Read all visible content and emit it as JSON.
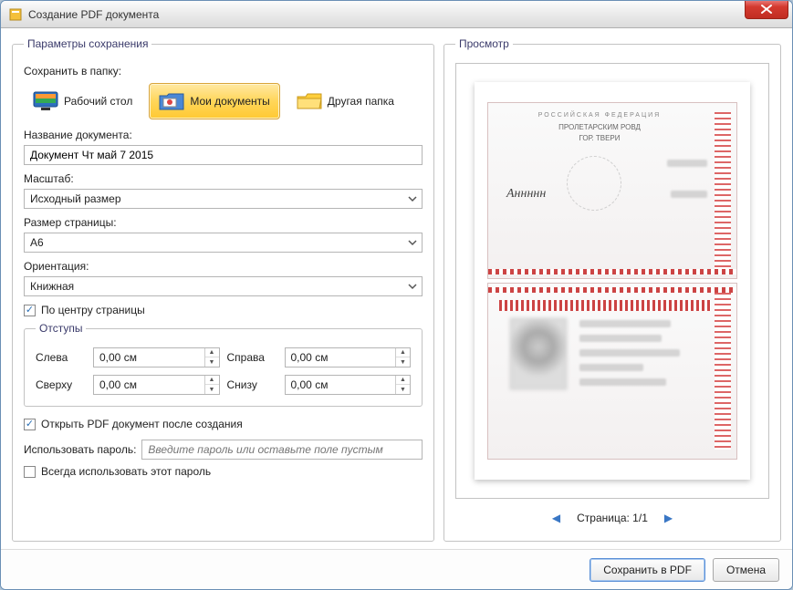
{
  "window": {
    "title": "Создание PDF документа"
  },
  "params": {
    "legend": "Параметры сохранения",
    "save_to_label": "Сохранить в папку:",
    "folders": {
      "desktop": "Рабочий стол",
      "documents": "Мои документы",
      "other": "Другая папка"
    },
    "docname_label": "Название документа:",
    "docname_value": "Документ Чт май 7 2015",
    "scale_label": "Масштаб:",
    "scale_value": "Исходный размер",
    "pagesize_label": "Размер страницы:",
    "pagesize_value": "A6",
    "orientation_label": "Ориентация:",
    "orientation_value": "Книжная",
    "center_label": "По центру страницы",
    "margins": {
      "legend": "Отступы",
      "left_label": "Слева",
      "left_value": "0,00 см",
      "right_label": "Справа",
      "right_value": "0,00 см",
      "top_label": "Сверху",
      "top_value": "0,00 см",
      "bottom_label": "Снизу",
      "bottom_value": "0,00 см"
    },
    "open_after_label": "Открыть PDF документ после создания",
    "password_label": "Использовать пароль:",
    "password_placeholder": "Введите пароль или оставьте поле пустым",
    "always_password_label": "Всегда использовать этот пароль"
  },
  "preview": {
    "legend": "Просмотр",
    "passport_country": "РОССИЙСКАЯ ФЕДЕРАЦИЯ",
    "passport_line2": "ПРОЛЕТАРСКИМ РОВД",
    "passport_line3": "ГОР. ТВЕРИ",
    "pager_label": "Страница: 1/1"
  },
  "footer": {
    "save": "Сохранить в PDF",
    "cancel": "Отмена"
  }
}
